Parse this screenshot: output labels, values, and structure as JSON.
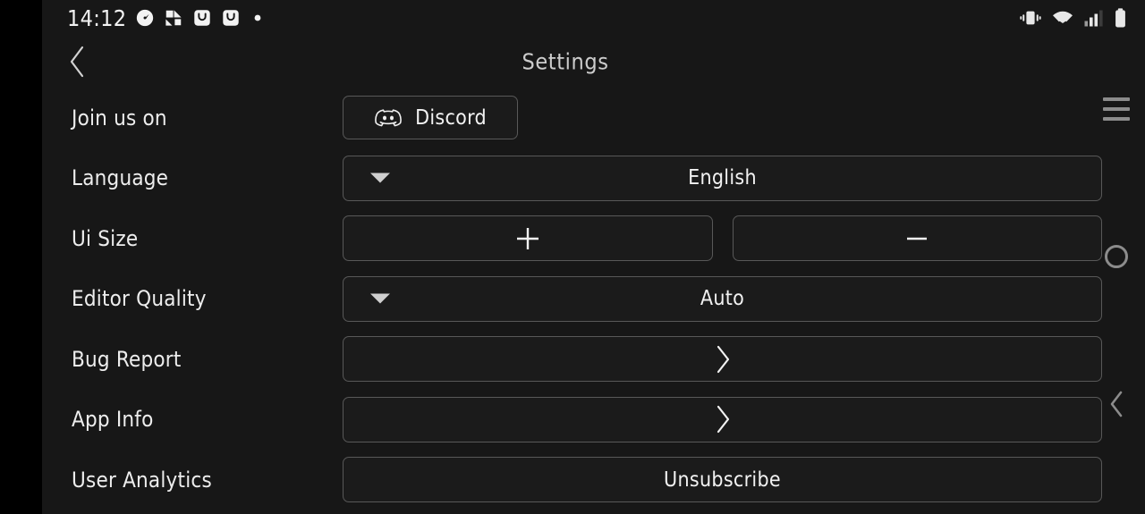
{
  "status_bar": {
    "clock": "14:12",
    "left_icons": [
      {
        "name": "speedometer-icon"
      },
      {
        "name": "app-badge-icon"
      },
      {
        "name": "shopping-bag-icon"
      },
      {
        "name": "shopping-bag-icon-2"
      },
      {
        "name": "dot-indicator-icon"
      }
    ],
    "right_icons": [
      {
        "name": "vibrate-icon"
      },
      {
        "name": "wifi-icon"
      },
      {
        "name": "cellular-signal-icon"
      },
      {
        "name": "battery-icon"
      }
    ]
  },
  "header": {
    "title": "Settings",
    "back_icon": "chevron-left-icon"
  },
  "rows": [
    {
      "label": "Join us on",
      "control_type": "link-button",
      "value": "Discord",
      "icon": "discord-logo-icon"
    },
    {
      "label": "Language",
      "control_type": "dropdown",
      "value": "English",
      "icon": "caret-down-icon"
    },
    {
      "label": "Ui Size",
      "control_type": "stepper",
      "increase_label": "+",
      "decrease_label": "—"
    },
    {
      "label": "Editor Quality",
      "control_type": "dropdown",
      "value": "Auto",
      "icon": "caret-down-icon"
    },
    {
      "label": "Bug Report",
      "control_type": "navigate",
      "value": "",
      "icon": "chevron-right-icon"
    },
    {
      "label": "App Info",
      "control_type": "navigate",
      "value": "",
      "icon": "chevron-right-icon"
    },
    {
      "label": "User Analytics",
      "control_type": "action-button",
      "value": "Unsubscribe"
    }
  ],
  "system_nav": {
    "menu_icon": "hamburger-menu-icon",
    "home_icon": "home-circle-icon",
    "back_icon": "chevron-left-icon"
  },
  "colors": {
    "background": "#171717",
    "sidebar_black": "#000000",
    "text_primary": "#ededed",
    "text_title": "#cccccc",
    "border": "#585858",
    "control_fill": "#1b1b1b",
    "nav_icon": "#8c8c8c"
  }
}
